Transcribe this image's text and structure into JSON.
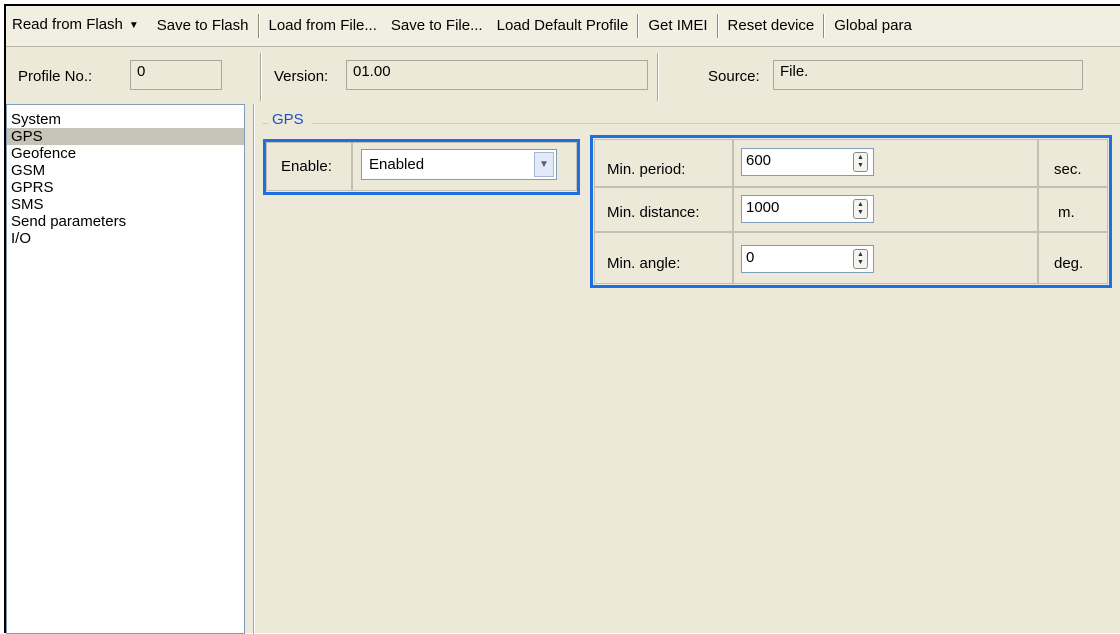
{
  "toolbar": {
    "read_from_flash": "Read from Flash",
    "save_to_flash": "Save to Flash",
    "load_from_file": "Load from File...",
    "save_to_file": "Save to File...",
    "load_default_profile": "Load Default Profile",
    "get_imei": "Get IMEI",
    "reset_device": "Reset device",
    "global_params": "Global para"
  },
  "info": {
    "profile_label": "Profile No.:",
    "profile_value": "0",
    "version_label": "Version:",
    "version_value": "01.00",
    "source_label": "Source:",
    "source_value": "File."
  },
  "sidebar": {
    "items": [
      {
        "label": "System"
      },
      {
        "label": "GPS"
      },
      {
        "label": "Geofence"
      },
      {
        "label": "GSM"
      },
      {
        "label": "GPRS"
      },
      {
        "label": "SMS"
      },
      {
        "label": "Send parameters"
      },
      {
        "label": "I/O"
      }
    ],
    "selected": "GPS"
  },
  "gps": {
    "group_title": "GPS",
    "enable_label": "Enable:",
    "enable_value": "Enabled",
    "min_period_label": "Min. period:",
    "min_period_value": "600",
    "min_period_unit": "sec.",
    "min_distance_label": "Min. distance:",
    "min_distance_value": "1000",
    "min_distance_unit": "m.",
    "min_angle_label": "Min. angle:",
    "min_angle_value": "0",
    "min_angle_unit": "deg."
  },
  "colors": {
    "highlight": "#1e6fe0",
    "group_title": "#1f4fc4",
    "window_bg": "#ece9d8"
  }
}
